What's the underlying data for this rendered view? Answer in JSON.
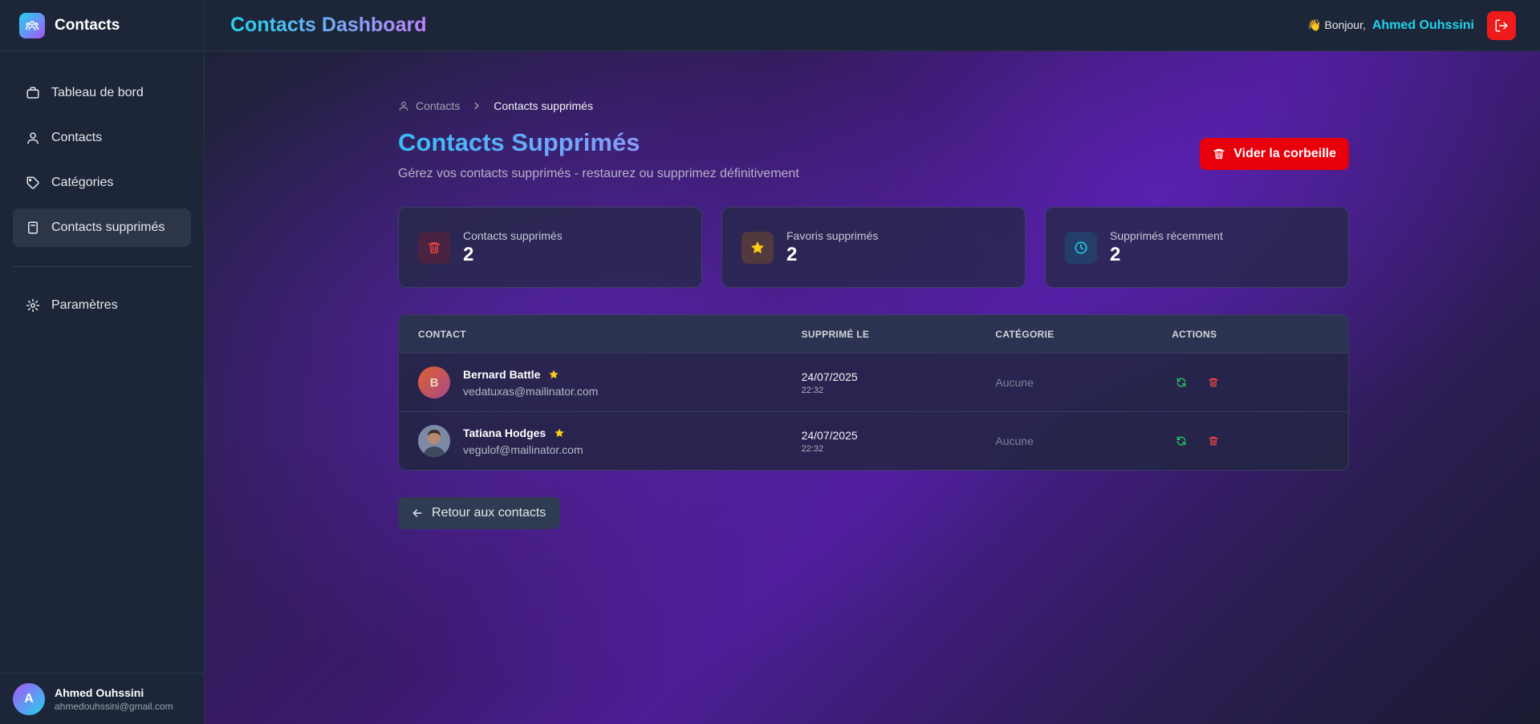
{
  "colors": {
    "accent_cyan": "#22d3ee",
    "accent_purple": "#c084fc",
    "danger": "#e7000b",
    "restore_green": "#22c55e",
    "delete_red": "#ef4444",
    "star_yellow": "#facc15"
  },
  "sidebar": {
    "brand": "Contacts",
    "brand_icon": "users-icon",
    "items": [
      {
        "label": "Tableau de bord",
        "icon": "briefcase-icon"
      },
      {
        "label": "Contacts",
        "icon": "user-icon"
      },
      {
        "label": "Catégories",
        "icon": "tag-icon"
      },
      {
        "label": "Contacts supprimés",
        "icon": "archive-icon",
        "active": true
      },
      {
        "label": "Paramètres",
        "icon": "gear-icon"
      }
    ],
    "user": {
      "initial": "A",
      "name": "Ahmed Ouhssini",
      "email": "ahmedouhssini@gmail.com"
    }
  },
  "header": {
    "title": "Contacts Dashboard",
    "greeting": "👋 Bonjour,",
    "user_name": "Ahmed Ouhssini",
    "logout_icon": "logout-icon"
  },
  "breadcrumb": {
    "parent": "Contacts",
    "current": "Contacts supprimés"
  },
  "page": {
    "title": "Contacts Supprimés",
    "subtitle": "Gérez vos contacts supprimés - restaurez ou supprimez définitivement",
    "empty_trash_label": "Vider la corbeille",
    "back_label": "Retour aux contacts"
  },
  "stats": [
    {
      "label": "Contacts supprimés",
      "value": "2",
      "icon": "trash-icon"
    },
    {
      "label": "Favoris supprimés",
      "value": "2",
      "icon": "star-icon"
    },
    {
      "label": "Supprimés récemment",
      "value": "2",
      "icon": "clock-icon"
    }
  ],
  "table": {
    "headers": [
      "CONTACT",
      "SUPPRIMÉ LE",
      "CATÉGORIE",
      "ACTIONS"
    ],
    "rows": [
      {
        "initial": "B",
        "name": "Bernard Battle",
        "email": "vedatuxas@mailinator.com",
        "favorite": true,
        "date": "24/07/2025",
        "time": "22:32",
        "category": "Aucune"
      },
      {
        "initial": "",
        "name": "Tatiana Hodges",
        "email": "vegulof@mailinator.com",
        "favorite": true,
        "date": "24/07/2025",
        "time": "22:32",
        "category": "Aucune"
      }
    ]
  }
}
